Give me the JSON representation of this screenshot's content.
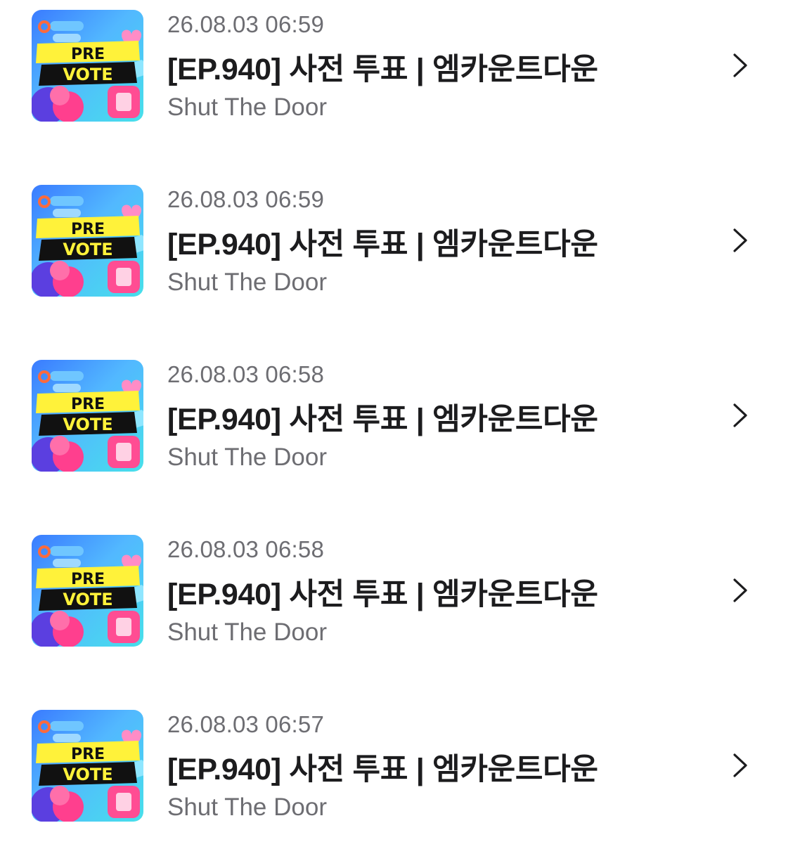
{
  "list": {
    "items": [
      {
        "timestamp": "26.08.03 06:59",
        "title": "[EP.940] 사전 투표 | 엠카운트다운",
        "channel": "Shut The Door",
        "thumbnail": {
          "line1": "PRE",
          "line2": "VOTE"
        }
      },
      {
        "timestamp": "26.08.03 06:59",
        "title": "[EP.940] 사전 투표 | 엠카운트다운",
        "channel": "Shut The Door",
        "thumbnail": {
          "line1": "PRE",
          "line2": "VOTE"
        }
      },
      {
        "timestamp": "26.08.03 06:58",
        "title": "[EP.940] 사전 투표 | 엠카운트다운",
        "channel": "Shut The Door",
        "thumbnail": {
          "line1": "PRE",
          "line2": "VOTE"
        }
      },
      {
        "timestamp": "26.08.03 06:58",
        "title": "[EP.940] 사전 투표 | 엠카운트다운",
        "channel": "Shut The Door",
        "thumbnail": {
          "line1": "PRE",
          "line2": "VOTE"
        }
      },
      {
        "timestamp": "26.08.03 06:57",
        "title": "[EP.940] 사전 투표 | 엠카운트다운",
        "channel": "Shut The Door",
        "thumbnail": {
          "line1": "PRE",
          "line2": "VOTE"
        }
      }
    ]
  },
  "icons": {
    "chevron": "chevron-right-icon"
  },
  "colors": {
    "title": "#1c1c1e",
    "secondary_text": "#6d6d72",
    "banner_yellow": "#fff23a",
    "banner_black": "#111111",
    "thumb_blue": "#3a7bff",
    "thumb_cyan": "#47e0ea",
    "accent_pink": "#ff3f8e"
  }
}
